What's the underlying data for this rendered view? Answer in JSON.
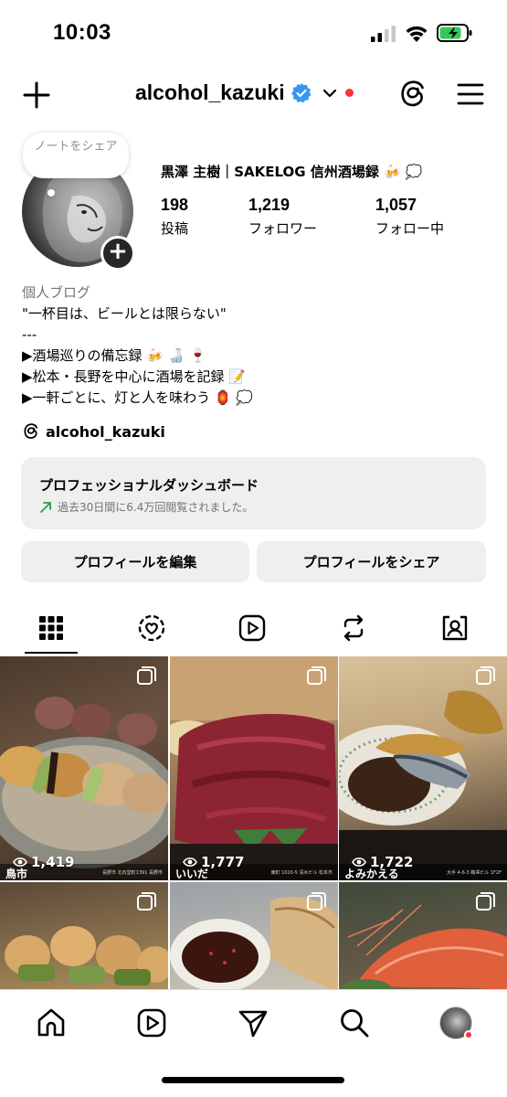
{
  "status_bar": {
    "time": "10:03"
  },
  "header": {
    "username": "alcohol_kazuki"
  },
  "note": {
    "label": "ノートをシェア"
  },
  "profile": {
    "display_name": "黒澤 主樹｜SAKELOG 信州酒場録 🍻 💭",
    "stats": [
      {
        "value": "198",
        "label": "投稿"
      },
      {
        "value": "1,219",
        "label": "フォロワー"
      },
      {
        "value": "1,057",
        "label": "フォロー中"
      }
    ]
  },
  "bio": {
    "category": "個人ブログ",
    "lines": [
      "\"一杯目は、ビールとは限らない\"",
      "---",
      "▶酒場巡りの備忘録 🍻 🍶 🍷",
      "▶松本・長野を中心に酒場を記録 📝",
      "▶一軒ごとに、灯と人を味わう 🏮 💭"
    ]
  },
  "threads_link": {
    "label": "alcohol_kazuki"
  },
  "dashboard": {
    "title": "プロフェッショナルダッシュボード",
    "subtitle": "過去30日間に6.4万回閲覧されました。",
    "trend_color": "#2c9c4a"
  },
  "buttons": {
    "edit": "プロフィールを編集",
    "share": "プロフィールをシェア"
  },
  "tabs": [
    "grid-icon",
    "reels-fav-icon",
    "reels-icon",
    "reposts-icon",
    "tagged-icon"
  ],
  "posts": [
    {
      "views": "1,419",
      "caption": "鳥市",
      "caption_small": "長野市 北石堂町1391 長野市"
    },
    {
      "views": "1,777",
      "caption": "いいだ",
      "caption_small": "東町 1020-5 清水ビル 松本市"
    },
    {
      "views": "1,722",
      "caption": "よみかえる",
      "caption_small": "大手 4-6-3 鵜澤ビル 1F2F"
    },
    {
      "views": "",
      "caption": "",
      "caption_small": ""
    },
    {
      "views": "",
      "caption": "",
      "caption_small": ""
    },
    {
      "views": "",
      "caption": "",
      "caption_small": ""
    }
  ],
  "colors": {
    "accent_red": "#ff3040",
    "verified_blue": "#3797f0",
    "button_gray": "#efefef"
  }
}
